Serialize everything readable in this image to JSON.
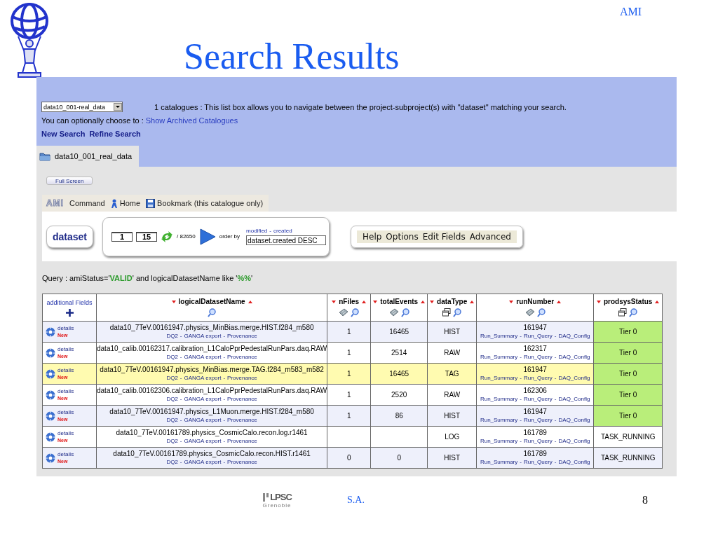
{
  "slide": {
    "corner_label": "AMI",
    "title": "Search Results",
    "footer_org": "LPSC",
    "footer_org_sub": "Grenoble",
    "footer_author": "S.A.",
    "page_number": "8"
  },
  "catalogue_bar": {
    "select_value": "data10_001-real_data",
    "info": "1 catalogues : This list box allows you to navigate between the project-subproject(s) with \"dataset\" matching your search.",
    "archived_prompt": "You can optionally choose to :",
    "archived_link": "Show Archived Catalogues",
    "links": [
      "New Search",
      "Refine Search"
    ]
  },
  "tabs": [
    {
      "label": "data10_001_real_data",
      "selected": true
    }
  ],
  "full_screen_button": "Full Screen",
  "toolbar": {
    "logo": "AMI",
    "items": [
      {
        "label": "Command",
        "kind": "text"
      },
      {
        "label": "Home",
        "kind": "home"
      },
      {
        "label": "Bookmark (this catalogue only)",
        "kind": "bookmark"
      }
    ]
  },
  "entity_button": "dataset",
  "paging": {
    "from": "1",
    "to": "15",
    "total": "/ 82650",
    "order_label": "order by",
    "order_links": [
      "modified",
      "created"
    ],
    "order_separator": "-",
    "order_value": "dataset.created DESC"
  },
  "menu": [
    "Help",
    "Options",
    "Edit Fields",
    "Advanced"
  ],
  "query": [
    {
      "text": "Query : amiStatus='",
      "kind": "plain"
    },
    {
      "text": "VALID",
      "kind": "value"
    },
    {
      "text": "' and logicalDatasetName like '",
      "kind": "plain"
    },
    {
      "text": "%%",
      "kind": "value"
    },
    {
      "text": "'",
      "kind": "plain"
    }
  ],
  "table": {
    "link_separator": "-",
    "columns": [
      {
        "label": "additional Fields",
        "kind": "add"
      },
      {
        "label": "logicalDatasetName",
        "kind": "text"
      },
      {
        "label": "nFiles",
        "kind": "numeric"
      },
      {
        "label": "totalEvents",
        "kind": "numeric"
      },
      {
        "label": "dataType",
        "kind": "list"
      },
      {
        "label": "runNumber",
        "kind": "numeric"
      },
      {
        "label": "prodsysStatus",
        "kind": "list"
      }
    ],
    "rows": [
      {
        "details": "details",
        "badge": "New",
        "name": "data10_7TeV.00161947.physics_MinBias.merge.HIST.f284_m580",
        "links": [
          "DQ2",
          "GANGA export",
          "Provenance"
        ],
        "nfiles": "1",
        "events": "16465",
        "type": "HIST",
        "run": "161947",
        "run_links": [
          "Run_Summary",
          "Run_Query",
          "DAQ_Config"
        ],
        "status": "Tier 0",
        "color": "#b9ee7a",
        "highlighted": false
      },
      {
        "details": "details",
        "badge": "New",
        "name": "data10_calib.00162317.calibration_L1CaloPprPedestalRunPars.daq.RAW",
        "links": [
          "DQ2",
          "GANGA export",
          "Provenance"
        ],
        "nfiles": "1",
        "events": "2514",
        "type": "RAW",
        "run": "162317",
        "run_links": [
          "Run_Summary",
          "Run_Query",
          "DAQ_Config"
        ],
        "status": "Tier 0",
        "color": "#b9ee7a",
        "highlighted": false
      },
      {
        "details": "details",
        "badge": "New",
        "name": "data10_7TeV.00161947.physics_MinBias.merge.TAG.f284_m583_m582",
        "links": [
          "DQ2",
          "GANGA export",
          "Provenance"
        ],
        "nfiles": "1",
        "events": "16465",
        "type": "TAG",
        "run": "161947",
        "run_links": [
          "Run_Summary",
          "Run_Query",
          "DAQ_Config"
        ],
        "status": "Tier 0",
        "color": "#b9ee7a",
        "highlighted": true
      },
      {
        "details": "details",
        "badge": "New",
        "name": "data10_calib.00162306.calibration_L1CaloPprPedestalRunPars.daq.RAW",
        "links": [
          "DQ2",
          "GANGA export",
          "Provenance"
        ],
        "nfiles": "1",
        "events": "2520",
        "type": "RAW",
        "run": "162306",
        "run_links": [
          "Run_Summary",
          "Run_Query",
          "DAQ_Config"
        ],
        "status": "Tier 0",
        "color": "#b9ee7a",
        "highlighted": false
      },
      {
        "details": "details",
        "badge": "New",
        "name": "data10_7TeV.00161947.physics_L1Muon.merge.HIST.f284_m580",
        "links": [
          "DQ2",
          "GANGA export",
          "Provenance"
        ],
        "nfiles": "1",
        "events": "86",
        "type": "HIST",
        "run": "161947",
        "run_links": [
          "Run_Summary",
          "Run_Query",
          "DAQ_Config"
        ],
        "status": "Tier 0",
        "color": "#b9ee7a",
        "highlighted": false
      },
      {
        "details": "details",
        "badge": "New",
        "name": "data10_7TeV.00161789.physics_CosmicCalo.recon.log.r1461",
        "links": [
          "DQ2",
          "GANGA export",
          "Provenance"
        ],
        "type": "LOG",
        "run": "161789",
        "run_links": [
          "Run_Summary",
          "Run_Query",
          "DAQ_Config"
        ],
        "status": "TASK_RUNNING",
        "highlighted": false
      },
      {
        "details": "details",
        "badge": "New",
        "name": "data10_7TeV.00161789.physics_CosmicCalo.recon.HIST.r1461",
        "links": [
          "DQ2",
          "GANGA export",
          "Provenance"
        ],
        "nfiles": "0",
        "events": "0",
        "type": "HIST",
        "run": "161789",
        "run_links": [
          "Run_Summary",
          "Run_Query",
          "DAQ_Config"
        ],
        "status": "TASK_RUNNING",
        "highlighted": false
      }
    ]
  }
}
